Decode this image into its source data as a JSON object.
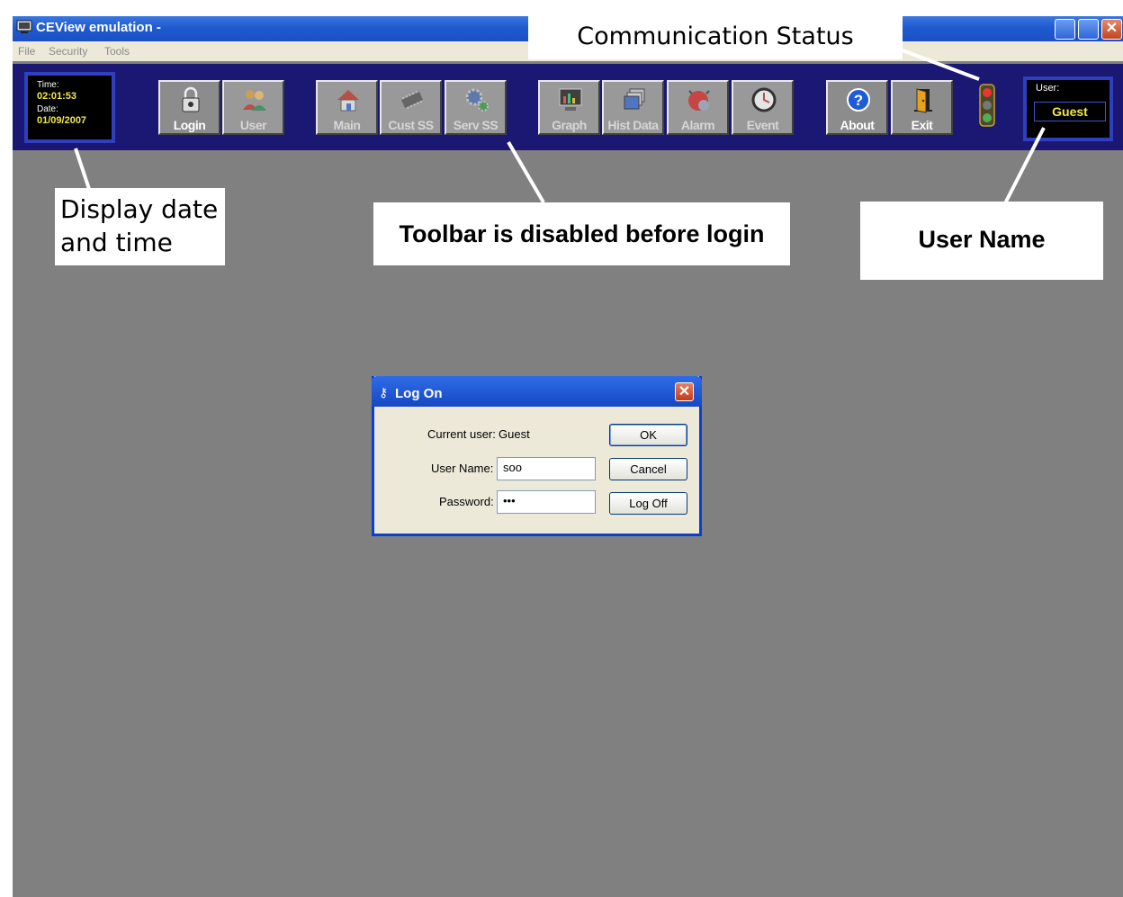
{
  "window": {
    "title": "CEView emulation -",
    "menu": [
      "File",
      "Security",
      "Tools"
    ]
  },
  "toolbar": {
    "time_label": "Time:",
    "time_value": "02:01:53",
    "date_label": "Date:",
    "date_value": "01/09/2007",
    "buttons": [
      {
        "label": "Login",
        "icon": "lock-icon",
        "enabled": true
      },
      {
        "label": "User",
        "icon": "users-icon",
        "enabled": false
      },
      {
        "label": "Main",
        "icon": "home-icon",
        "enabled": false
      },
      {
        "label": "Cust SS",
        "icon": "chip-icon",
        "enabled": false
      },
      {
        "label": "Serv SS",
        "icon": "gears-icon",
        "enabled": false
      },
      {
        "label": "Graph",
        "icon": "monitor-chart-icon",
        "enabled": false
      },
      {
        "label": "Hist Data",
        "icon": "stacked-pages-icon",
        "enabled": false
      },
      {
        "label": "Alarm",
        "icon": "alarm-bell-icon",
        "enabled": false
      },
      {
        "label": "Event",
        "icon": "clock-icon",
        "enabled": false
      },
      {
        "label": "About",
        "icon": "help-icon",
        "enabled": true
      },
      {
        "label": "Exit",
        "icon": "exit-door-icon",
        "enabled": true
      }
    ],
    "user_label": "User:",
    "user_value": "Guest",
    "status_icon": "traffic-light-icon"
  },
  "dialog": {
    "title": "Log On",
    "current_user_label": "Current user:",
    "current_user_value": "Guest",
    "username_label": "User Name:",
    "username_value": "soo",
    "password_label": "Password:",
    "password_value": "•••",
    "ok_label": "OK",
    "cancel_label": "Cancel",
    "logoff_label": "Log Off"
  },
  "callouts": {
    "communication_status": "Communication Status",
    "display_date_time": [
      "Display date",
      "and time"
    ],
    "toolbar_disabled": "Toolbar is disabled before login",
    "user_name": "User Name"
  },
  "colors": {
    "toolbar_bg": "#1a1872",
    "panel_border": "#2f3fc0",
    "value_yellow": "#f1e84a",
    "desktop_gray": "#808080",
    "titlebar_blue": "#1f5ad0"
  }
}
